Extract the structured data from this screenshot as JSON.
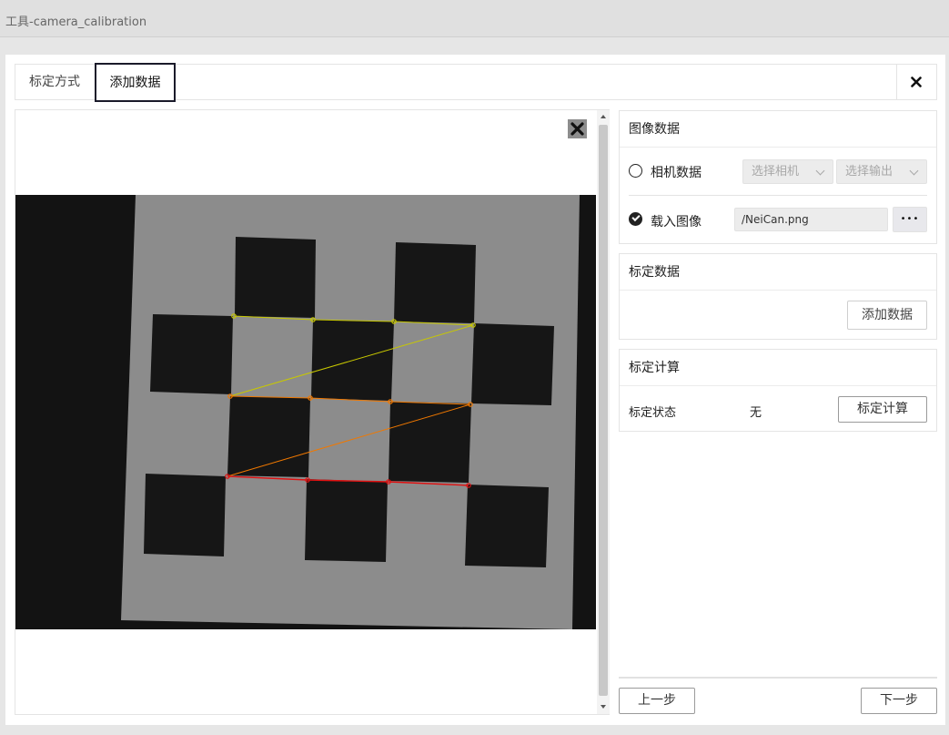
{
  "window": {
    "title": "工具-camera_calibration"
  },
  "tabs": {
    "calib_method": "标定方式",
    "add_data": "添加数据"
  },
  "image_data": {
    "header": "图像数据",
    "camera_data_label": "相机数据",
    "select_camera_placeholder": "选择相机",
    "select_output_placeholder": "选择输出",
    "load_image_label": "载入图像",
    "image_path": "/NeiCan.png",
    "browse_label": "•••"
  },
  "calib_data": {
    "header": "标定数据",
    "add_button": "添加数据"
  },
  "calib_compute": {
    "header": "标定计算",
    "status_label": "标定状态",
    "status_value": "无",
    "compute_button": "标定计算"
  },
  "footer": {
    "prev_button": "上一步",
    "next_button": "下一步"
  },
  "colors": {
    "tab_border": "#1a1a2a",
    "corner_row1": "#c8c800",
    "corner_row2": "#f07800",
    "corner_row3": "#e01010"
  }
}
